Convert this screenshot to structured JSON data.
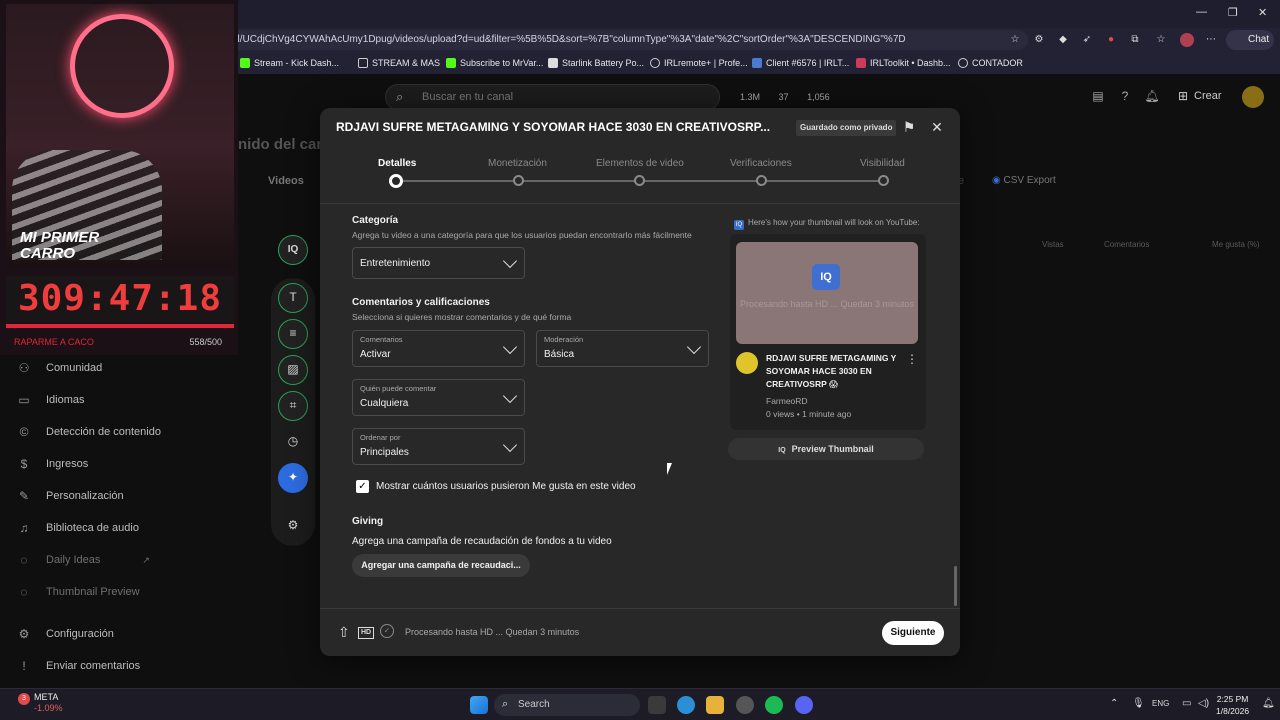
{
  "browser": {
    "url": "el/UCdjChVg4CYWAhAcUmy1Dpug/videos/upload?d=ud&filter=%5B%5D&sort=%7B\"columnType\"%3A\"date\"%2C\"sortOrder\"%3A\"DESCENDING\"%7D",
    "bookmarks": [
      "Stream - Kick Dash...",
      "STREAM & MAS",
      "Subscribe to MrVar...",
      "Starlink Battery Po...",
      "IRLremote+ | Profe...",
      "Client #6576 | IRLT...",
      "IRLToolkit • Dashb...",
      "CONTADOR"
    ],
    "chat_label": "Chat"
  },
  "header": {
    "search_placeholder": "Buscar en tu canal",
    "stats": [
      "1.3M",
      "37",
      "1,056"
    ],
    "create_label": "Crear"
  },
  "background": {
    "page_title_fragment": "nido del cana",
    "tab_fragment": "n",
    "videos_tab": "Videos",
    "export_label": "CSV Export",
    "col_views": "Vistas",
    "col_comments": "Comentarios",
    "col_likes": "Me gusta (%)",
    "tab_fragment_right": "e"
  },
  "sidebar": {
    "items": [
      {
        "label": "Comunidad",
        "icon": "community-icon"
      },
      {
        "label": "Idiomas",
        "icon": "languages-icon"
      },
      {
        "label": "Detección de contenido",
        "icon": "copyright-icon"
      },
      {
        "label": "Ingresos",
        "icon": "dollar-icon"
      },
      {
        "label": "Personalización",
        "icon": "customization-icon"
      },
      {
        "label": "Biblioteca de audio",
        "icon": "audio-library-icon"
      },
      {
        "label": "Daily Ideas",
        "icon": "ideas-icon"
      },
      {
        "label": "Thumbnail Preview",
        "icon": "thumbnail-icon"
      },
      {
        "label": "Configuración",
        "icon": "settings-icon"
      },
      {
        "label": "Enviar comentarios",
        "icon": "feedback-icon"
      }
    ]
  },
  "stream_overlay": {
    "banner": "MI PRIMER CARRO",
    "timer": "309:47:18",
    "footer_left": "RAPARME A CACO",
    "footer_right": "558/500"
  },
  "modal": {
    "title": "RDJAVI SUFRE METAGAMING Y SOYOMAR HACE 3030 EN CREATIVOSRP...",
    "saved_badge": "Guardado como privado",
    "steps": [
      "Detalles",
      "Monetización",
      "Elementos de video",
      "Verificaciones",
      "Visibilidad"
    ],
    "active_step": 0,
    "category": {
      "heading": "Categoría",
      "description": "Agrega tu video a una categoría para que los usuarios puedan encontrarlo más fácilmente",
      "value": "Entretenimiento"
    },
    "comments": {
      "heading": "Comentarios y calificaciones",
      "description": "Selecciona si quieres mostrar comentarios y de qué forma",
      "comments_label": "Comentarios",
      "comments_value": "Activar",
      "moderation_label": "Moderación",
      "moderation_value": "Básica",
      "who_label": "Quién puede comentar",
      "who_value": "Cualquiera",
      "sort_label": "Ordenar por",
      "sort_value": "Principales"
    },
    "likes_checkbox": "Mostrar cuántos usuarios pusieron Me gusta en este video",
    "giving": {
      "heading": "Giving",
      "description": "Agrega una campaña de recaudación de fondos a tu video",
      "button": "Agregar una campaña de recaudaci..."
    },
    "footer_status": "Procesando hasta HD ... Quedan 3 minutos",
    "next_button": "Siguiente",
    "preview": {
      "note": "Here's how your thumbnail will look on YouTube:",
      "processing": "Procesando hasta HD ... Quedan 3 minutos",
      "video_title": "RDJAVI SUFRE METAGAMING Y SOYOMAR HACE 3030 EN CREATIVOSRP 😱",
      "channel": "FarmeoRD",
      "meta": "0 views • 1 minute ago",
      "button": "Preview Thumbnail"
    }
  },
  "taskbar": {
    "ticker_name": "META",
    "ticker_change": "-1.09%",
    "search_label": "Search",
    "language": "ENG",
    "time": "2:25 PM",
    "date": "1/8/2026"
  },
  "colors": {
    "accent_green": "#2aa15a",
    "timer_red": "#ef3d3d",
    "modal_bg": "#282828"
  }
}
